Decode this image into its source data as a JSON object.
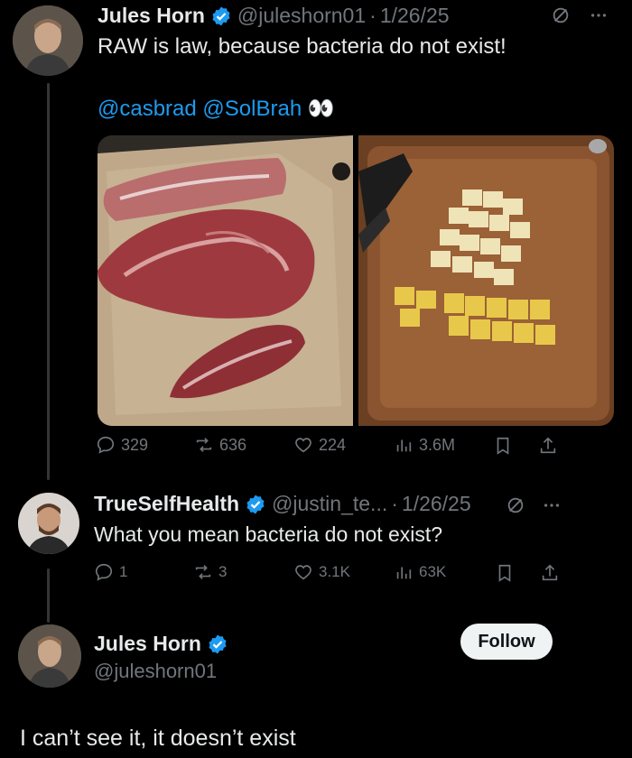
{
  "tweet1": {
    "author_name": "Jules Horn",
    "handle": "@juleshorn01",
    "separator": "·",
    "date": "1/26/25",
    "text": "RAW is law, because bacteria do not exist!",
    "mention1": "@casbrad",
    "mention2": "@SolBrah",
    "emoji": "👀",
    "stats": {
      "replies": "329",
      "reposts": "636",
      "likes": "224",
      "views": "3.6M"
    }
  },
  "tweet2": {
    "author_name": "TrueSelfHealth",
    "handle": "@justin_te...",
    "separator": "·",
    "date": "1/26/25",
    "text": "What you mean bacteria do not exist?",
    "stats": {
      "replies": "1",
      "reposts": "3",
      "likes": "3.1K",
      "views": "63K"
    }
  },
  "profile_card": {
    "author_name": "Jules Horn",
    "handle": "@juleshorn01",
    "follow_label": "Follow"
  },
  "caption": "I can’t see it, it doesn’t exist",
  "colors": {
    "background": "#000000",
    "accent": "#1d9bf0",
    "muted": "#71767b",
    "text": "#e7e9ea",
    "verified": "#1d9bf0"
  },
  "icons": [
    "edited-icon",
    "more-icon",
    "reply-icon",
    "repost-icon",
    "like-icon",
    "views-icon",
    "bookmark-icon",
    "share-icon",
    "verified-badge-icon"
  ]
}
